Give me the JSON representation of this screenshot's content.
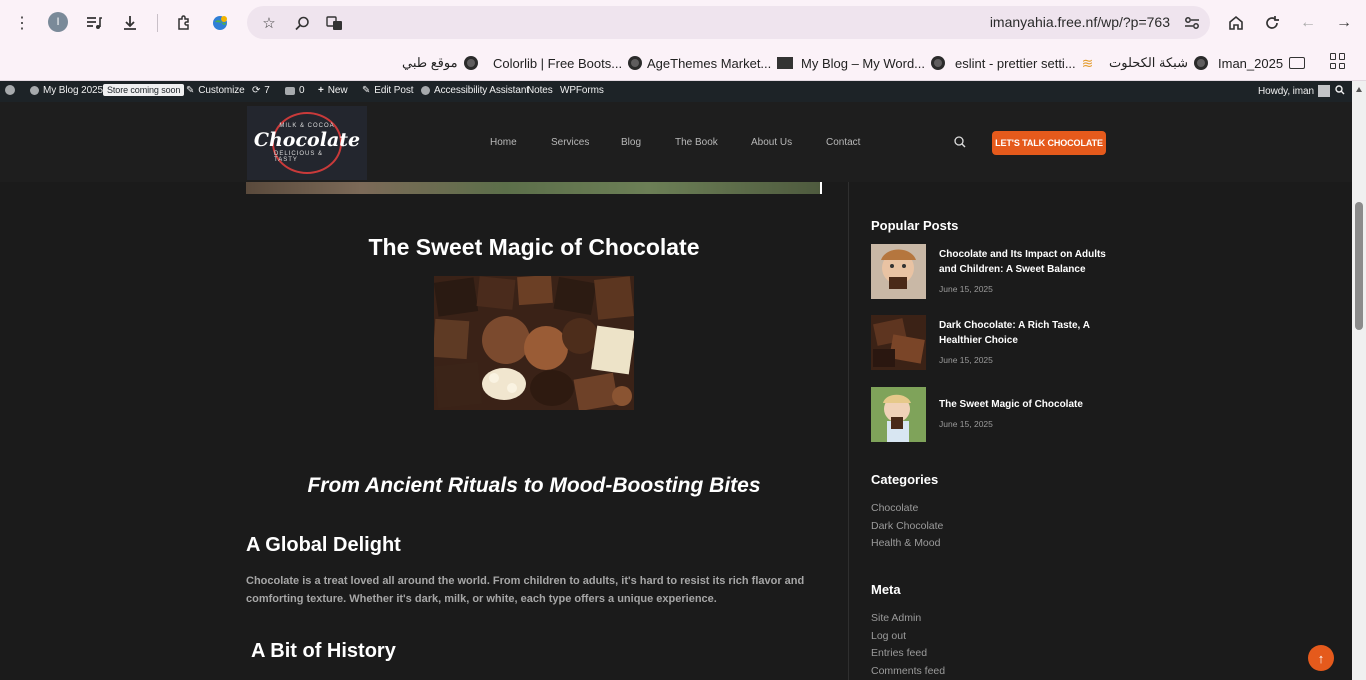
{
  "browser": {
    "profile_initial": "I",
    "url": "imanyahia.free.nf/wp/?p=763",
    "bookmarks": [
      {
        "label": "موقع طبي",
        "icon": "globe-icon"
      },
      {
        "label": "Colorlib | Free Boots...",
        "icon": "globe-icon"
      },
      {
        "label": "AgeThemes Market...",
        "icon": "globe-icon"
      },
      {
        "label": "My Blog – My Word...",
        "icon": "agethemes-icon"
      },
      {
        "label": "eslint - prettier setti...",
        "icon": "globe-icon"
      },
      {
        "label": "شبكة الكحلوت",
        "icon": "stack-icon"
      },
      {
        "label": "Iman_2025",
        "icon": "globe-icon"
      }
    ]
  },
  "adminbar": {
    "site_name": "My Blog 2025",
    "store_badge": "Store coming soon",
    "customize": "Customize",
    "updates_count": "7",
    "comments_count": "0",
    "new": "New",
    "edit_post": "Edit Post",
    "accessibility": "Accessibility Assistant",
    "notes": "Notes",
    "wpforms": "WPForms",
    "howdy": "Howdy, iman"
  },
  "site": {
    "logo_top": "MILK & COCOA",
    "logo_main": "Chocolate",
    "logo_bottom": "DELICIOUS & TASTY",
    "nav": [
      "Home",
      "Services",
      "Blog",
      "The Book",
      "About Us",
      "Contact"
    ],
    "cta": "LET'S TALK CHOCOLATE",
    "accent": "#e55a1c"
  },
  "post": {
    "title": "The Sweet Magic of Chocolate",
    "subtitle": "From Ancient Rituals to Mood-Boosting Bites",
    "section1_heading": "A Global Delight",
    "section1_text": "Chocolate is a treat loved all around the world. From children to adults, it's hard to resist its rich flavor and comforting texture. Whether it's dark, milk, or white, each type offers a unique experience.",
    "section2_heading": "A Bit of History"
  },
  "sidebar": {
    "popular_title": "Popular Posts",
    "popular": [
      {
        "title": "Chocolate and Its Impact on Adults and Children: A Sweet Balance",
        "date": "June 15, 2025"
      },
      {
        "title": "Dark Chocolate: A Rich Taste, A Healthier Choice",
        "date": "June 15, 2025"
      },
      {
        "title": "The Sweet Magic of Chocolate",
        "date": "June 15, 2025"
      }
    ],
    "categories_title": "Categories",
    "categories": [
      "Chocolate",
      "Dark Chocolate",
      "Health & Mood"
    ],
    "meta_title": "Meta",
    "meta": [
      "Site Admin",
      "Log out",
      "Entries feed",
      "Comments feed"
    ]
  }
}
